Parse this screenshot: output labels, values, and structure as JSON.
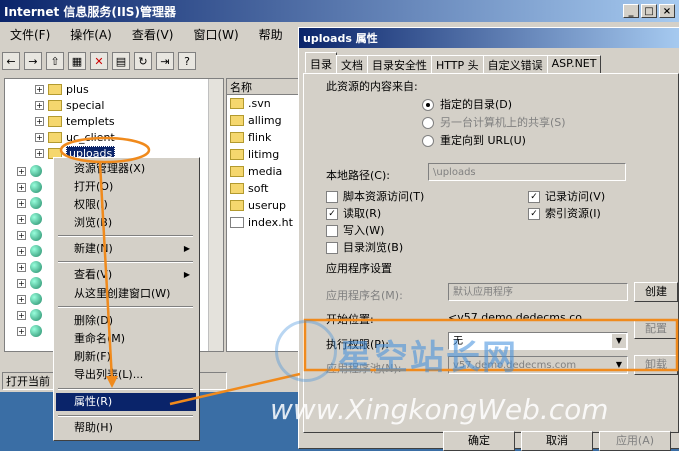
{
  "iis": {
    "title": "Internet 信息服务(IIS)管理器",
    "menu": [
      "文件(F)",
      "操作(A)",
      "查看(V)",
      "窗口(W)",
      "帮助"
    ],
    "tree": [
      "plus",
      "special",
      "templets",
      "uc_client",
      "uploads"
    ],
    "list_header": "名称",
    "list": [
      ".svn",
      "allimg",
      "flink",
      "litimg",
      "media",
      "soft",
      "userup",
      "index.ht"
    ],
    "status": "打开当前"
  },
  "context_menu": {
    "items": [
      "资源管理器(X)",
      "打开(O)",
      "权限(I)",
      "浏览(B)",
      "新建(N)",
      "查看(V)",
      "从这里创建窗口(W)",
      "删除(D)",
      "重命名(M)",
      "刷新(F)",
      "导出列表(L)...",
      "属性(R)",
      "帮助(H)"
    ]
  },
  "dialog": {
    "title": "uploads 属性",
    "tabs": [
      "目录",
      "文档",
      "目录安全性",
      "HTTP 头",
      "自定义错误",
      "ASP.NET"
    ],
    "source_heading": "此资源的内容来自:",
    "radio_1": "指定的目录(D)",
    "radio_2": "另一台计算机上的共享(S)",
    "radio_3": "重定向到 URL(U)",
    "local_path_label": "本地路径(C):",
    "local_path_value": "\\uploads",
    "chk_script": "脚本资源访问(T)",
    "chk_read": "读取(R)",
    "chk_write": "写入(W)",
    "chk_browse": "目录浏览(B)",
    "chk_log": "记录访问(V)",
    "chk_index": "索引资源(I)",
    "app_settings": "应用程序设置",
    "app_name_label": "应用程序名(M):",
    "app_name_value": "默认应用程序",
    "create_btn": "创建",
    "start_label": "开始位置:",
    "start_value": "<v57.demo.dedecms.co...",
    "config_btn": "配置",
    "exec_label": "执行权限(P):",
    "exec_value": "无",
    "pool_label": "应用程序池(N):",
    "pool_value": "v57.demo.dedecms.com",
    "unload_btn": "卸载",
    "ok": "确定",
    "cancel": "取消",
    "apply": "应用(A)"
  },
  "watermark": {
    "brand": "星空站长网",
    "url": "www.XingkongWeb.com"
  },
  "colors": {
    "annotation": "#f08a1c",
    "titlebar": "#0a246a",
    "selection": "#0a246a"
  }
}
